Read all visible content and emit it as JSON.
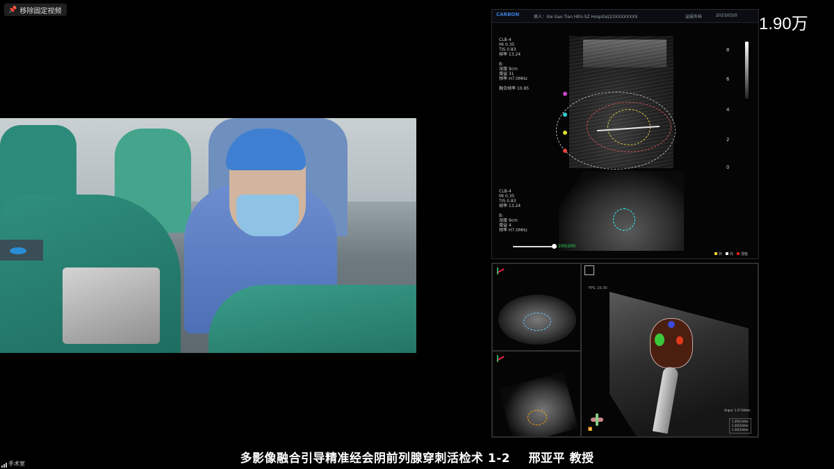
{
  "toolbar": {
    "unpin_label": "移除固定视频"
  },
  "views": {
    "count": "1.90万",
    "icon": "eye-icon"
  },
  "ultrasound": {
    "brand": "CARBON",
    "patient_info": "病人：Xie Gao Tian HEU-SZ Hospital/23XXXXXXXX",
    "department": "泌尿外科",
    "date": "2023/03/0",
    "params_top": [
      "CLB-4",
      "MI 0.35",
      "TIS 0.83",
      "帧率 13.24",
      "",
      "B:",
      "深度 9cm",
      "增益 31",
      "频率 H7.0MHz",
      "",
      "融合帧率 10.85"
    ],
    "params_bottom": [
      "CLB-4",
      "MI 0.35",
      "TIS 0.83",
      "帧率 13.24",
      "",
      "B:",
      "深度 9cm",
      "增益 4",
      "频率 H7.0MHz"
    ],
    "scale_ticks": [
      "8",
      "6",
      "4",
      "2",
      "0"
    ],
    "slider_label": "200/200",
    "legend": [
      {
        "label": "外",
        "color": "#f2d12c"
      },
      {
        "label": "内",
        "color": "#f2f2f2"
      },
      {
        "label": "活检",
        "color": "#e2231a"
      }
    ]
  },
  "render3d": {
    "fps_label": "FPS: 20.30",
    "organ_label": "Organ: 1.27 Bitlets",
    "organ_legend": [
      "1.30(1)Inter",
      "1.30(2)Inter",
      "1.30(3)Inter"
    ]
  },
  "caption": {
    "title": "多影像融合引导精准经会阴前列腺穿刺活检术 1-2",
    "presenter": "邢亚平 教授"
  },
  "status": {
    "room": "手术室"
  },
  "colors": {
    "accent": "#3a7bd5",
    "drape": "#2f8f7e",
    "lesion_green": "#3ac73a",
    "lesion_red": "#e23a1a"
  }
}
